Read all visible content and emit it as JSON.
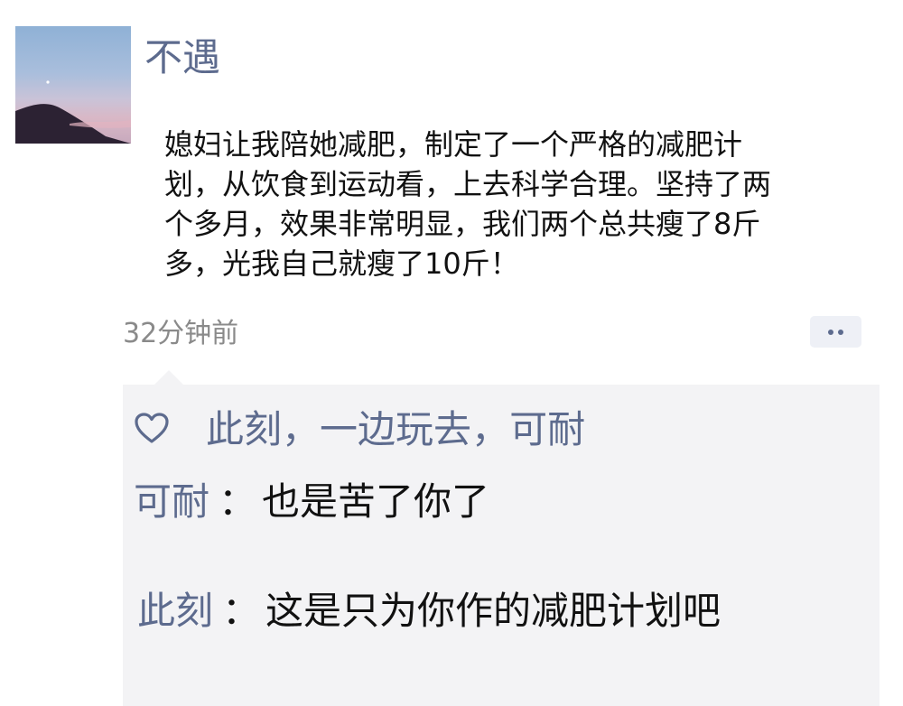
{
  "post": {
    "author": "不遇",
    "text": "媳妇让我陪她减肥，制定了一个严格的减肥计划，从饮食到运动看，上去科学合理。坚持了两个多月，效果非常明显，我们两个总共瘦了8斤多，光我自己就瘦了10斤！",
    "timestamp": "32分钟前"
  },
  "likes": {
    "names": [
      "此刻",
      "一边玩去",
      "可耐"
    ],
    "separator": "，"
  },
  "comments": [
    {
      "author": "可耐",
      "separator": "：",
      "text": "也是苦了你了"
    },
    {
      "author": "此刻",
      "separator": "：",
      "text": "这是只为你作的减肥计划吧"
    }
  ],
  "icons": {
    "like": "heart-icon",
    "more": "more-dots-icon"
  },
  "colors": {
    "link": "#5d6b8e",
    "comment_bg": "#f3f3f5",
    "timestamp": "#8a8a8a"
  }
}
